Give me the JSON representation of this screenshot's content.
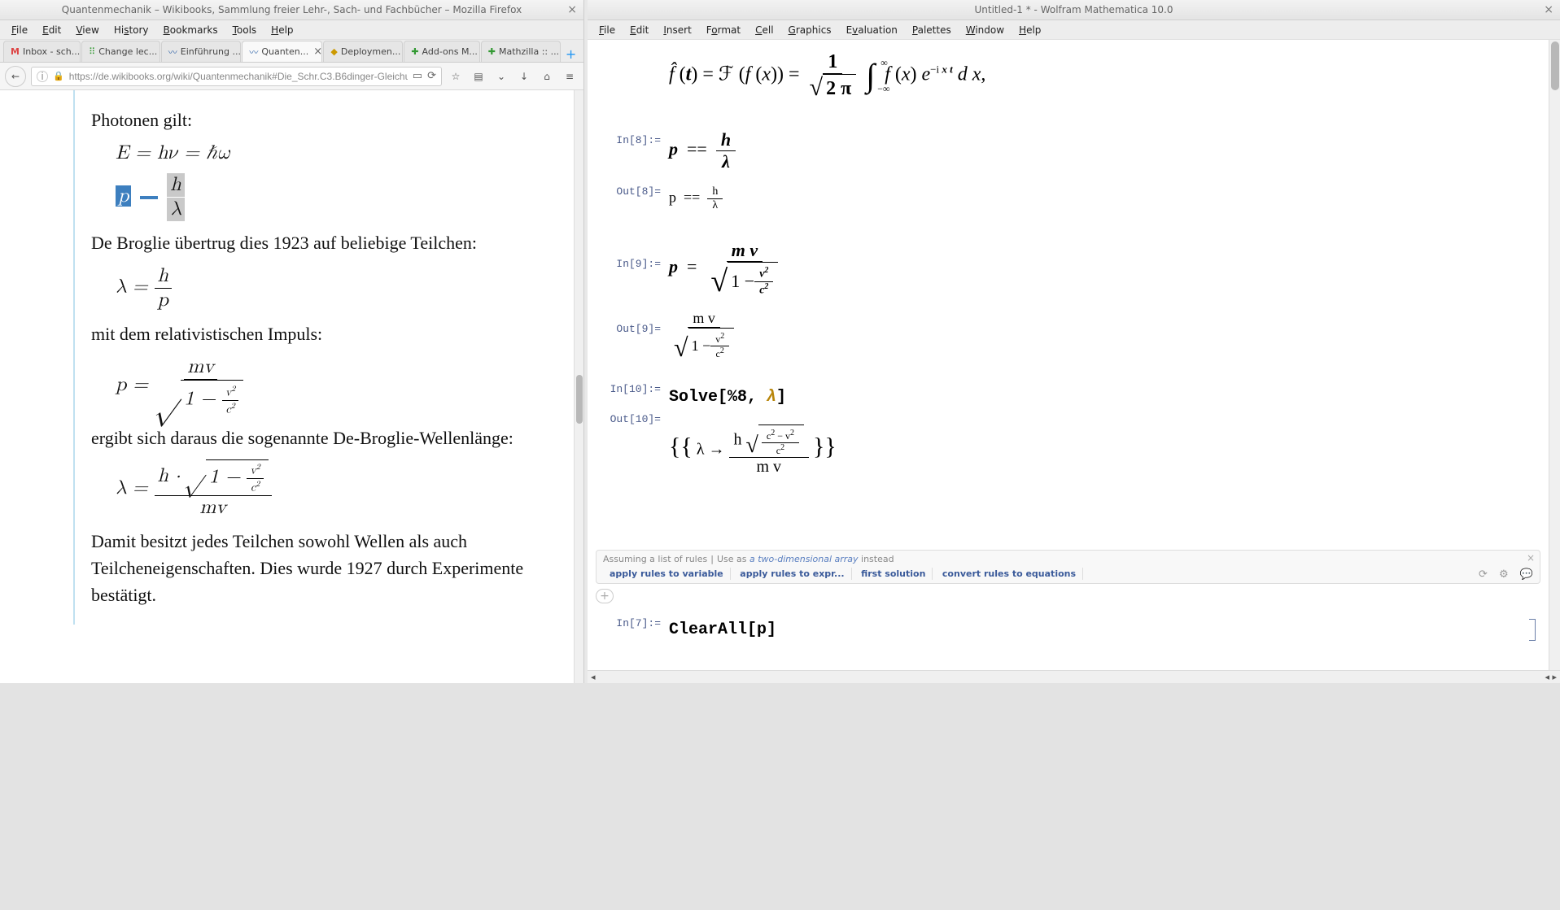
{
  "firefox": {
    "title": "Quantenmechanik – Wikibooks, Sammlung freier Lehr-, Sach- und Fachbücher – Mozilla Firefox",
    "menu": [
      "File",
      "Edit",
      "View",
      "History",
      "Bookmarks",
      "Tools",
      "Help"
    ],
    "tabs": [
      {
        "label": "Inbox - sch...",
        "icon": "M",
        "color": "#d44"
      },
      {
        "label": "Change lec...",
        "icon": "⠿",
        "color": "#393"
      },
      {
        "label": "Einführung ...",
        "icon": "〰",
        "color": "#36a"
      },
      {
        "label": "Quanten...",
        "icon": "〰",
        "color": "#36a",
        "active": true
      },
      {
        "label": "Deploymen...",
        "icon": "◆",
        "color": "#c90"
      },
      {
        "label": "Add-ons M...",
        "icon": "✚",
        "color": "#393"
      },
      {
        "label": "Mathzilla :: ...",
        "icon": "✚",
        "color": "#393"
      }
    ],
    "url": "https://de.wikibooks.org/wiki/Quantenmechanik#Die_Schr.C3.B6dinger-Gleichung",
    "article": {
      "p1": "Photonen gilt:",
      "eq1": "E = hν = ℏω",
      "p2": "De Broglie übertrug dies 1923 auf beliebige Teilchen:",
      "p3": "mit dem relativistischen Impuls:",
      "p4": "ergibt sich daraus die sogenannte De-Broglie-Wellenlänge:",
      "p5": "Damit besitzt jedes Teilchen sowohl Wellen als auch Teilcheneigenschaften. Dies wurde 1927 durch Experimente bestätigt."
    }
  },
  "mma": {
    "title": "Untitled-1 * - Wolfram Mathematica 10.0",
    "menu": [
      "File",
      "Edit",
      "Insert",
      "Format",
      "Cell",
      "Graphics",
      "Evaluation",
      "Palettes",
      "Window",
      "Help"
    ],
    "cells": {
      "in8": "In[8]:=",
      "out8": "Out[8]=",
      "in9": "In[9]:=",
      "out9": "Out[9]=",
      "in10": "In[10]:=",
      "out10": "Out[10]=",
      "in7": "In[7]:=",
      "solveCode": "Solve[%8, ",
      "solveLambda": "λ",
      "solveClose": "]",
      "clearall": "ClearAll[p]"
    },
    "sugg": {
      "assume": "Assuming a list of rules",
      "useas": "Use as",
      "twoD": "a two-dimensional array",
      "instead": "instead",
      "opts": [
        "apply rules to variable",
        "apply rules to expr...",
        "first solution",
        "convert rules to equations"
      ]
    }
  }
}
